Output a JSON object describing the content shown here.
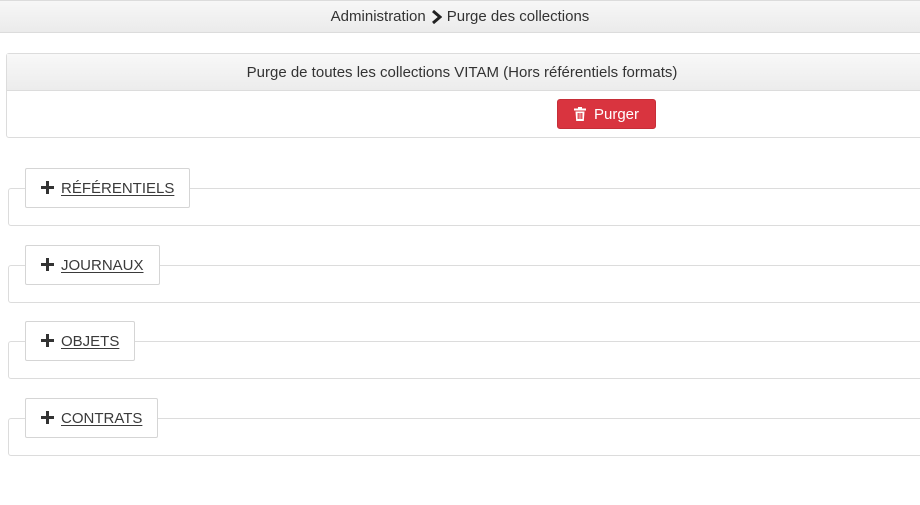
{
  "breadcrumb": {
    "items": [
      "Administration",
      "Purge des collections"
    ],
    "separator_icon": "chevron-right-icon"
  },
  "purge_panel": {
    "title": "Purge de toutes les collections VITAM (Hors référentiels formats)",
    "button_label": "Purger",
    "button_icon": "trash-icon",
    "button_color": "#d9343f"
  },
  "sections": [
    {
      "label": "RÉFÉRENTIELS",
      "icon": "plus-icon"
    },
    {
      "label": "JOURNAUX",
      "icon": "plus-icon"
    },
    {
      "label": "OBJETS",
      "icon": "plus-icon"
    },
    {
      "label": "CONTRATS",
      "icon": "plus-icon"
    }
  ]
}
